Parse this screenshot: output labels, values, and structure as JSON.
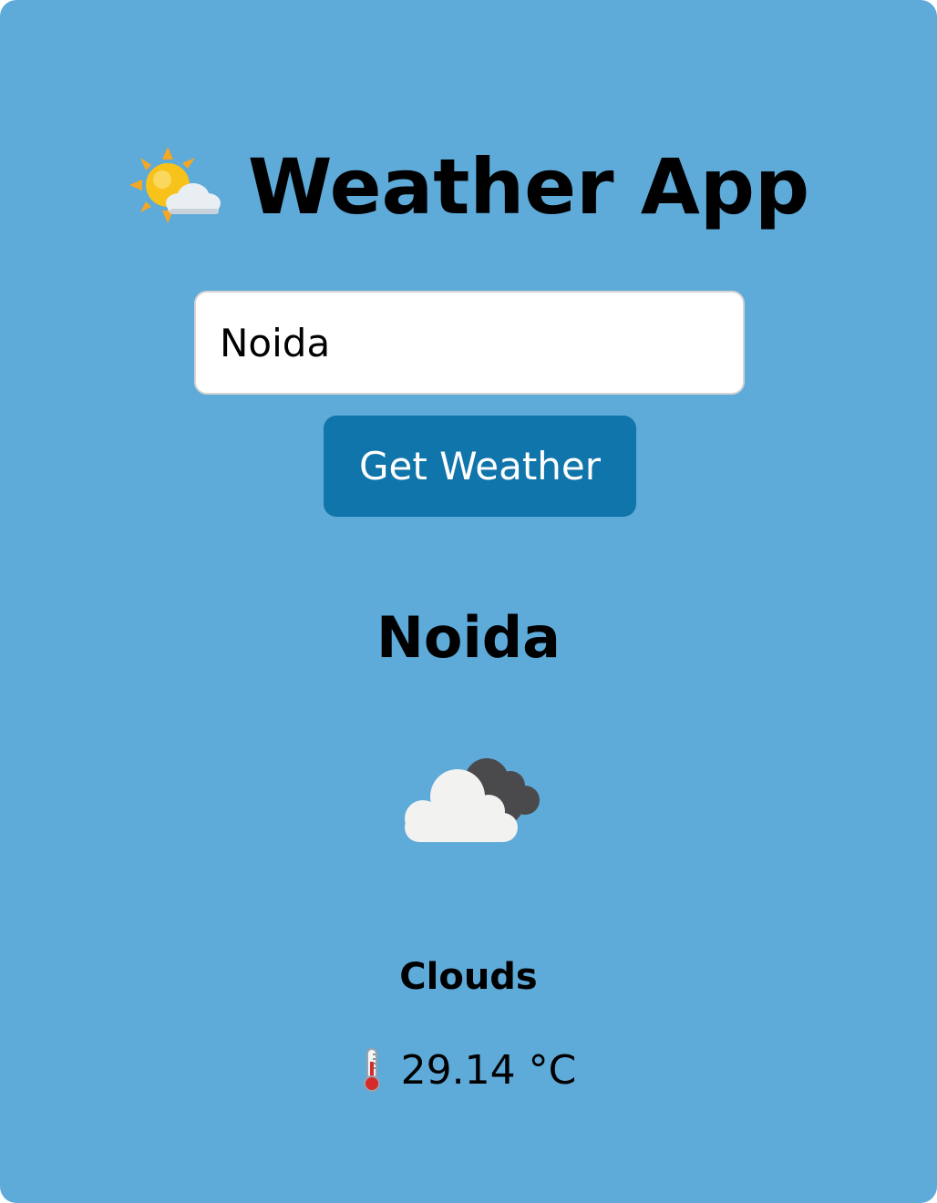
{
  "app": {
    "title": "Weather App",
    "title_icon": "sun-behind-cloud-icon"
  },
  "search": {
    "value": "Noida",
    "button_label": "Get Weather"
  },
  "result": {
    "city": "Noida",
    "weather_icon": "cloudy-icon",
    "condition": "Clouds",
    "temperature_icon": "thermometer-icon",
    "temperature": "29.14 °C"
  },
  "colors": {
    "background": "#5eaad9",
    "button": "#0f75ab",
    "input_background": "#ffffff",
    "text": "#000000"
  }
}
